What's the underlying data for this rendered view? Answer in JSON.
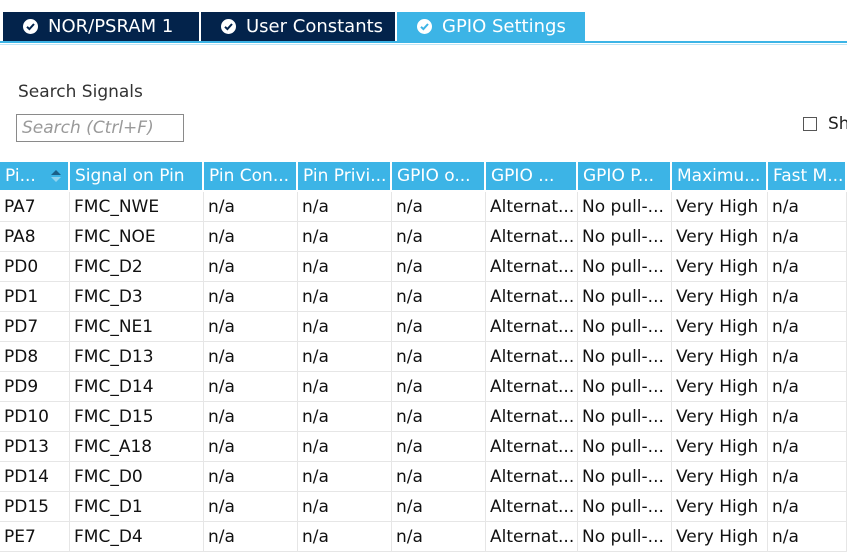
{
  "tabs": [
    {
      "label": "NOR/PSRAM 1",
      "active": false
    },
    {
      "label": "User Constants",
      "active": false
    },
    {
      "label": "GPIO Settings",
      "active": true
    }
  ],
  "search": {
    "label": "Search Signals",
    "placeholder": "Search (Ctrl+F)",
    "value": ""
  },
  "show_option": {
    "label": "Sh",
    "checked": false
  },
  "colors": {
    "tab_dark": "#03234b",
    "accent": "#3cb4e6"
  },
  "table": {
    "columns": [
      "Pi...",
      "Signal on Pin",
      "Pin Con...",
      "Pin Privi...",
      "GPIO o...",
      "GPIO ...",
      "GPIO P...",
      "Maximu...",
      "Fast M..."
    ],
    "sort_column": 0,
    "rows": [
      [
        "PA7",
        "FMC_NWE",
        "n/a",
        "n/a",
        "n/a",
        "Alternat...",
        "No pull-...",
        "Very High",
        "n/a"
      ],
      [
        "PA8",
        "FMC_NOE",
        "n/a",
        "n/a",
        "n/a",
        "Alternat...",
        "No pull-...",
        "Very High",
        "n/a"
      ],
      [
        "PD0",
        "FMC_D2",
        "n/a",
        "n/a",
        "n/a",
        "Alternat...",
        "No pull-...",
        "Very High",
        "n/a"
      ],
      [
        "PD1",
        "FMC_D3",
        "n/a",
        "n/a",
        "n/a",
        "Alternat...",
        "No pull-...",
        "Very High",
        "n/a"
      ],
      [
        "PD7",
        "FMC_NE1",
        "n/a",
        "n/a",
        "n/a",
        "Alternat...",
        "No pull-...",
        "Very High",
        "n/a"
      ],
      [
        "PD8",
        "FMC_D13",
        "n/a",
        "n/a",
        "n/a",
        "Alternat...",
        "No pull-...",
        "Very High",
        "n/a"
      ],
      [
        "PD9",
        "FMC_D14",
        "n/a",
        "n/a",
        "n/a",
        "Alternat...",
        "No pull-...",
        "Very High",
        "n/a"
      ],
      [
        "PD10",
        "FMC_D15",
        "n/a",
        "n/a",
        "n/a",
        "Alternat...",
        "No pull-...",
        "Very High",
        "n/a"
      ],
      [
        "PD13",
        "FMC_A18",
        "n/a",
        "n/a",
        "n/a",
        "Alternat...",
        "No pull-...",
        "Very High",
        "n/a"
      ],
      [
        "PD14",
        "FMC_D0",
        "n/a",
        "n/a",
        "n/a",
        "Alternat...",
        "No pull-...",
        "Very High",
        "n/a"
      ],
      [
        "PD15",
        "FMC_D1",
        "n/a",
        "n/a",
        "n/a",
        "Alternat...",
        "No pull-...",
        "Very High",
        "n/a"
      ],
      [
        "PE7",
        "FMC_D4",
        "n/a",
        "n/a",
        "n/a",
        "Alternat...",
        "No pull-...",
        "Very High",
        "n/a"
      ]
    ]
  }
}
